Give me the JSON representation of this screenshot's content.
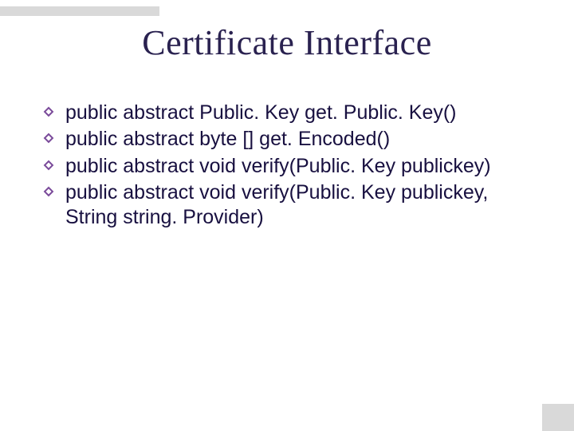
{
  "title": "Certificate Interface",
  "bullets": [
    {
      "text": "public abstract Public. Key get. Public. Key()"
    },
    {
      "text": "public abstract byte [] get. Encoded()"
    },
    {
      "text": "public abstract void verify(Public. Key publickey)"
    },
    {
      "text": "public abstract void verify(Public. Key publickey, String string. Provider)"
    }
  ],
  "bullet_color": "#7a4a9a"
}
